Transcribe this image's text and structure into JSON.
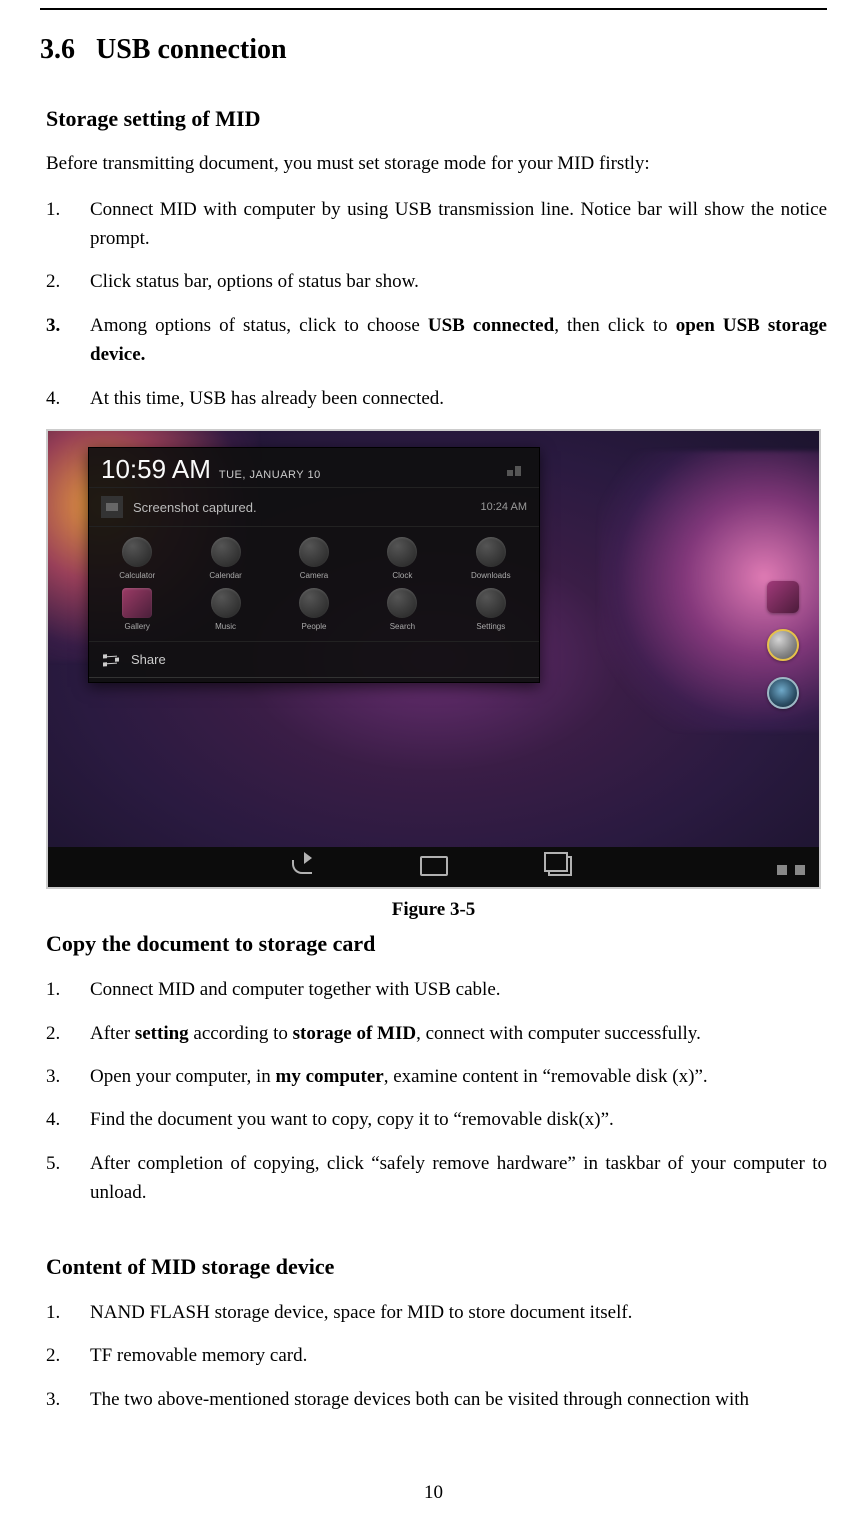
{
  "heading": {
    "number": "3.6",
    "title": "USB connection"
  },
  "section1": {
    "title": "Storage setting of MID",
    "intro": "Before transmitting document, you must set storage mode for your MID firstly:",
    "items": [
      {
        "num": "1.",
        "text": "Connect MID with computer by using USB transmission line. Notice bar will show the notice prompt."
      },
      {
        "num": "2.",
        "text": "Click status bar, options of status bar show."
      },
      {
        "num": "3.",
        "prefix": "Among options of status, click to choose ",
        "bold1": "USB connected",
        "mid": ", then click to ",
        "bold2": "open USB storage device.",
        "is_bold_row": true
      },
      {
        "num": "4.",
        "text": "At this time, USB has already been connected."
      }
    ]
  },
  "screenshot": {
    "time": "10:59 AM",
    "date": "TUE, JANUARY 10",
    "notification": {
      "label": "Screenshot captured.",
      "time": "10:24 AM"
    },
    "apps_row1": [
      "Calculator",
      "Calendar",
      "Camera",
      "Clock",
      "Downloads"
    ],
    "apps_row2": [
      "Gallery",
      "Music",
      "People",
      "Search",
      "Settings"
    ],
    "share_label": "Share"
  },
  "figure_caption": "Figure 3-5",
  "section2": {
    "title": "Copy the document to storage card",
    "items": [
      {
        "num": "1.",
        "text": "Connect MID and computer together with USB cable."
      },
      {
        "num": "2.",
        "prefix": "After ",
        "bold1": "setting",
        "mid": " according to ",
        "bold2": "storage of MID",
        "suffix": ", connect with computer successfully."
      },
      {
        "num": "3.",
        "prefix": "Open your computer, in ",
        "bold1": "my computer",
        "suffix": ", examine content in “removable disk (x)”."
      },
      {
        "num": "4.",
        "text": "Find the document you want to copy, copy it to “removable disk(x)”."
      },
      {
        "num": "5.",
        "text": "After completion of copying, click “safely remove hardware” in taskbar of your computer to unload."
      }
    ]
  },
  "section3": {
    "title": "Content of MID storage device",
    "items": [
      {
        "num": "1.",
        "text": "NAND FLASH storage device, space for MID to store document itself."
      },
      {
        "num": "2.",
        "text": "TF removable memory card."
      },
      {
        "num": "3.",
        "text": "The two above-mentioned storage devices both can be visited through connection with"
      }
    ]
  },
  "page_number": "10"
}
